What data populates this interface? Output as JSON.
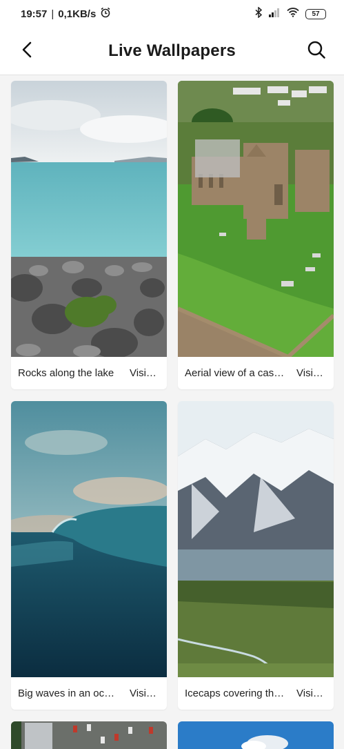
{
  "status_bar": {
    "time": "19:57",
    "separator": "|",
    "network_speed": "0,1KB/s",
    "battery_level": "57",
    "icons": [
      "alarm-icon",
      "bluetooth-icon",
      "signal-icon",
      "wifi-icon",
      "battery-icon"
    ]
  },
  "header": {
    "title": "Live Wallpapers",
    "back_icon": "back-arrow-icon",
    "search_icon": "search-icon"
  },
  "cards": [
    {
      "title": "Rocks along the lake",
      "source": "Visio…"
    },
    {
      "title": "Aerial view of a cast…",
      "source": "Visi…"
    },
    {
      "title": "Big waves in an oce…",
      "source": "Visi…"
    },
    {
      "title": "Icecaps covering th…",
      "source": "Visi…"
    }
  ],
  "colors": {
    "background": "#f4f4f4",
    "surface": "#ffffff",
    "text": "#1a1a1a"
  }
}
